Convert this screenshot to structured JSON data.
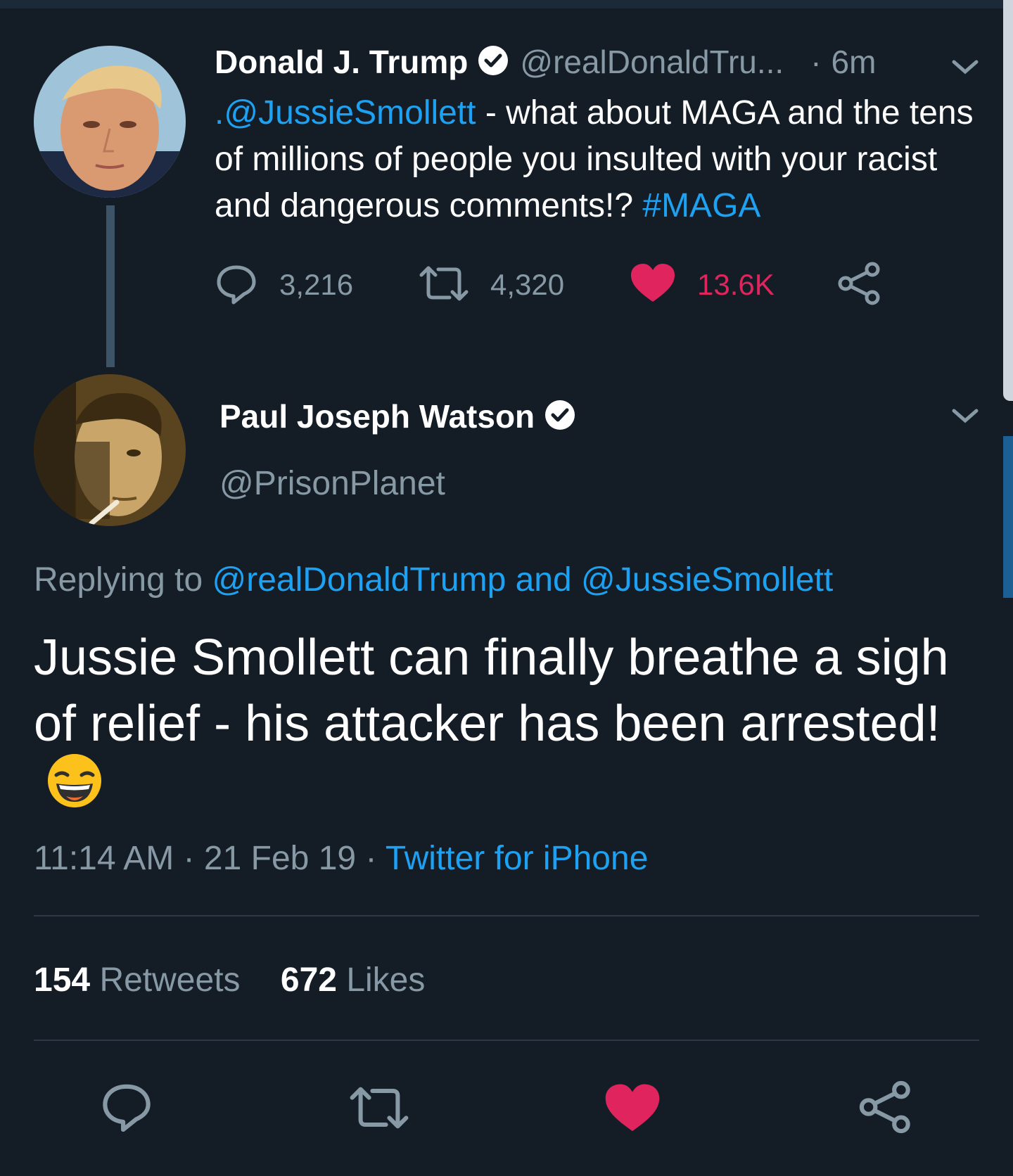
{
  "tweet1": {
    "name": "Donald J. Trump",
    "handle": "@realDonaldTru...",
    "separator": "·",
    "time": "6m",
    "text_mention": ".@JussieSmollett",
    "text_body": " - what about MAGA and the tens of millions of people you insulted with your racist and dangerous comments!? ",
    "text_hashtag": "#MAGA",
    "replies": "3,216",
    "retweets": "4,320",
    "likes": "13.6K"
  },
  "tweet2": {
    "name": "Paul Joseph Watson",
    "handle": "@PrisonPlanet",
    "replying_prefix": "Replying to ",
    "replying_targets": "@realDonaldTrump and @JussieSmollett",
    "text": "Jussie Smollett can finally breathe a sigh of relief - his attacker has been arrested!",
    "time": "11:14 AM",
    "dot1": "·",
    "date": "21 Feb 19",
    "dot2": "·",
    "source": "Twitter for iPhone",
    "retweet_count": "154",
    "retweet_label": "Retweets",
    "like_count": "672",
    "like_label": "Likes"
  },
  "colors": {
    "background": "#141d26",
    "link": "#1da1f2",
    "secondary_text": "#8899a6",
    "like": "#e0245e"
  },
  "icons": [
    "verified-badge-icon",
    "chevron-down-icon",
    "reply-icon",
    "retweet-icon",
    "heart-icon",
    "share-icon",
    "grinning-emoji-icon"
  ]
}
